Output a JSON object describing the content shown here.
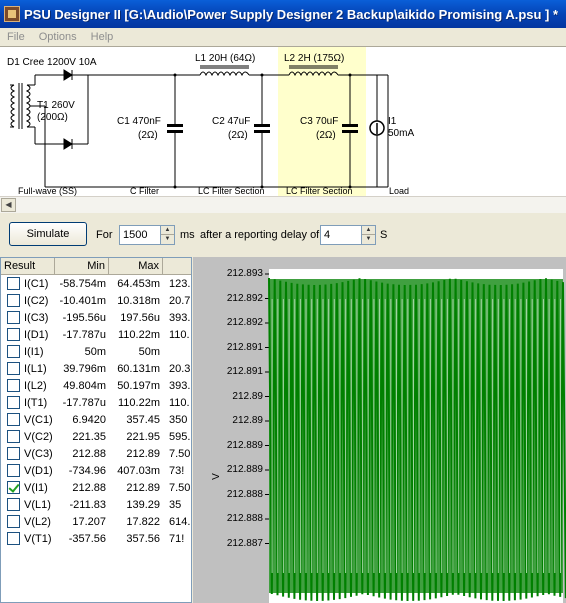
{
  "window": {
    "title": "PSU Designer II  [G:\\Audio\\Power Supply Designer 2 Backup\\aikido Promising A.psu ] *"
  },
  "menu": [
    "File",
    "Options",
    "Help"
  ],
  "schematic": {
    "d1_label": "D1 Cree 1200V 10A",
    "t1_label": "T1 260V",
    "t1_res": "(200Ω)",
    "l1_label": "L1 20H (64Ω)",
    "l2_label": "L2 2H (175Ω)",
    "c1_label": "C1 470nF",
    "c1_res": "(2Ω)",
    "c2_label": "C2 47uF",
    "c2_res": "(2Ω)",
    "c3_label": "C3 70uF",
    "c3_res": "(2Ω)",
    "i1_label": "I1",
    "i1_value": "50mA",
    "sections": [
      "Full-wave (SS)",
      "C Filter",
      "LC Filter Section",
      "LC Filter Section",
      "Load"
    ]
  },
  "controls": {
    "simulate_label": "Simulate",
    "for_label": "For",
    "duration_value": "1500",
    "ms_label": "ms",
    "delay_label": "after a reporting delay of",
    "delay_value": "4",
    "s_label": "S"
  },
  "results": {
    "headers": [
      "Result",
      "Min",
      "Max",
      ""
    ],
    "rows": [
      {
        "name": "I(C1)",
        "min": "-58.754m",
        "max": "64.453m",
        "extra": "123.",
        "checked": false
      },
      {
        "name": "I(C2)",
        "min": "-10.401m",
        "max": "10.318m",
        "extra": "20.7",
        "checked": false
      },
      {
        "name": "I(C3)",
        "min": "-195.56u",
        "max": "197.56u",
        "extra": "393.",
        "checked": false
      },
      {
        "name": "I(D1)",
        "min": "-17.787u",
        "max": "110.22m",
        "extra": "110.",
        "checked": false
      },
      {
        "name": "I(I1)",
        "min": "50m",
        "max": "50m",
        "extra": "",
        "checked": false
      },
      {
        "name": "I(L1)",
        "min": "39.796m",
        "max": "60.131m",
        "extra": "20.3",
        "checked": false
      },
      {
        "name": "I(L2)",
        "min": "49.804m",
        "max": "50.197m",
        "extra": "393.",
        "checked": false
      },
      {
        "name": "I(T1)",
        "min": "-17.787u",
        "max": "110.22m",
        "extra": "110.",
        "checked": false
      },
      {
        "name": "V(C1)",
        "min": "6.9420",
        "max": "357.45",
        "extra": "350",
        "checked": false
      },
      {
        "name": "V(C2)",
        "min": "221.35",
        "max": "221.95",
        "extra": "595.",
        "checked": false
      },
      {
        "name": "V(C3)",
        "min": "212.88",
        "max": "212.89",
        "extra": "7.50",
        "checked": false
      },
      {
        "name": "V(D1)",
        "min": "-734.96",
        "max": "407.03m",
        "extra": "73!",
        "checked": false
      },
      {
        "name": "V(I1)",
        "min": "212.88",
        "max": "212.89",
        "extra": "7.50",
        "checked": true
      },
      {
        "name": "V(L1)",
        "min": "-211.83",
        "max": "139.29",
        "extra": "35",
        "checked": false
      },
      {
        "name": "V(L2)",
        "min": "17.207",
        "max": "17.822",
        "extra": "614.",
        "checked": false
      },
      {
        "name": "V(T1)",
        "min": "-357.56",
        "max": "357.56",
        "extra": "71!",
        "checked": false
      }
    ]
  },
  "plot": {
    "ylabel": "V",
    "y_ticks": [
      "212.893",
      "212.892",
      "212.892",
      "212.891",
      "212.891",
      "212.89",
      "212.89",
      "212.889",
      "212.889",
      "212.888",
      "212.888",
      "212.887"
    ],
    "ripple_cycles": 52,
    "colors": {
      "trace": "#008000",
      "background": "#ffffff",
      "frame": "#c0c0c0",
      "highlight": "#ffffcc"
    }
  }
}
